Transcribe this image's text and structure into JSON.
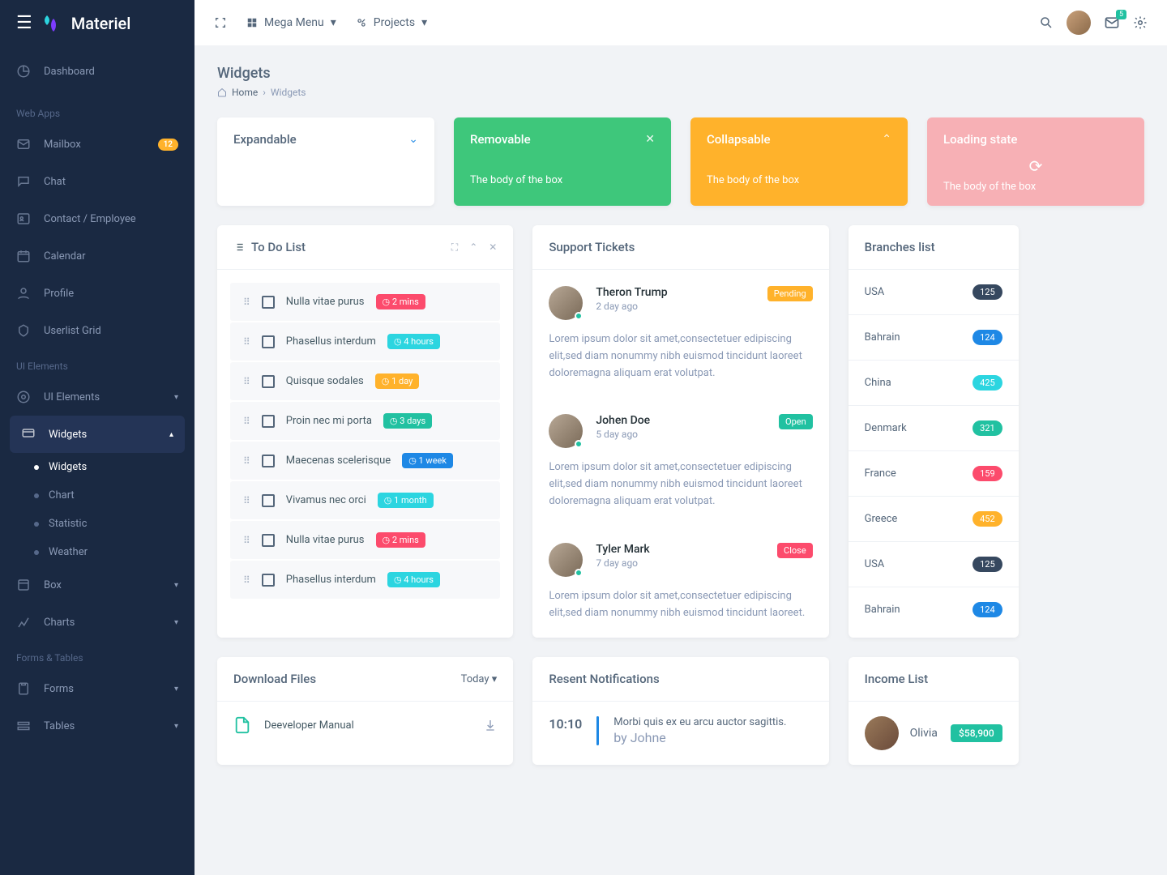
{
  "brand": {
    "name": "Materiel"
  },
  "topbar": {
    "mega_menu": "Mega Menu",
    "projects": "Projects",
    "mail_count": "5"
  },
  "page": {
    "title": "Widgets",
    "crumb_home": "Home",
    "crumb_current": "Widgets"
  },
  "sidebar": {
    "items": [
      {
        "label": "Dashboard"
      }
    ],
    "heading_webapps": "Web Apps",
    "webapps": [
      {
        "label": "Mailbox",
        "badge": "12"
      },
      {
        "label": "Chat"
      },
      {
        "label": "Contact / Employee"
      },
      {
        "label": "Calendar"
      },
      {
        "label": "Profile"
      },
      {
        "label": "Userlist Grid"
      }
    ],
    "heading_ui": "UI Elements",
    "ui_items": [
      {
        "label": "UI Elements"
      },
      {
        "label": "Widgets"
      }
    ],
    "widgets_sub": [
      {
        "label": "Widgets"
      },
      {
        "label": "Chart"
      },
      {
        "label": "Statistic"
      },
      {
        "label": "Weather"
      }
    ],
    "box": "Box",
    "charts": "Charts",
    "heading_forms": "Forms & Tables",
    "forms": "Forms",
    "tables": "Tables"
  },
  "panels": {
    "expandable": "Expandable",
    "removable": "Removable",
    "collapsable": "Collapsable",
    "loading": "Loading state",
    "body": "The body of the box"
  },
  "todo": {
    "title": "To Do List",
    "items": [
      {
        "text": "Nulla vitae purus",
        "badge": "2 mins",
        "cls": "danger"
      },
      {
        "text": "Phasellus interdum",
        "badge": "4 hours",
        "cls": "info"
      },
      {
        "text": "Quisque sodales",
        "badge": "1 day",
        "cls": "warning"
      },
      {
        "text": "Proin nec mi porta",
        "badge": "3 days",
        "cls": "success"
      },
      {
        "text": "Maecenas scelerisque",
        "badge": "1 week",
        "cls": "primary"
      },
      {
        "text": "Vivamus nec orci",
        "badge": "1 month",
        "cls": "info"
      },
      {
        "text": "Nulla vitae purus",
        "badge": "2 mins",
        "cls": "danger"
      },
      {
        "text": "Phasellus interdum",
        "badge": "4 hours",
        "cls": "info"
      }
    ]
  },
  "tickets": {
    "title": "Support Tickets",
    "lorem": "Lorem ipsum dolor sit amet,consectetuer edipiscing elit,sed diam nonummy nibh euismod tincidunt laoreet doloremagna aliquam erat volutpat.",
    "lorem_short": "Lorem ipsum dolor sit amet,consectetuer edipiscing elit,sed diam nonummy nibh euismod tincidunt laoreet.",
    "list": [
      {
        "name": "Theron Trump",
        "time": "2 day ago",
        "status": "Pending",
        "cls": "pending"
      },
      {
        "name": "Johen Doe",
        "time": "5 day ago",
        "status": "Open",
        "cls": "open"
      },
      {
        "name": "Tyler Mark",
        "time": "7 day ago",
        "status": "Close",
        "cls": "close"
      }
    ]
  },
  "branches": {
    "title": "Branches list",
    "list": [
      {
        "name": "USA",
        "badge": "125",
        "color": "#36485f"
      },
      {
        "name": "Bahrain",
        "badge": "124",
        "color": "#1e88e5"
      },
      {
        "name": "China",
        "badge": "425",
        "color": "#2cd5e0"
      },
      {
        "name": "Denmark",
        "badge": "321",
        "color": "#21c1a1"
      },
      {
        "name": "France",
        "badge": "159",
        "color": "#fc4b6c"
      },
      {
        "name": "Greece",
        "badge": "452",
        "color": "#ffb22b"
      },
      {
        "name": "USA",
        "badge": "125",
        "color": "#36485f"
      },
      {
        "name": "Bahrain",
        "badge": "124",
        "color": "#1e88e5"
      }
    ]
  },
  "downloads": {
    "title": "Download Files",
    "today": "Today",
    "file": "Deeveloper Manual"
  },
  "notifications": {
    "title": "Resent Notifications",
    "time": "10:10",
    "text": "Morbi quis ex eu arcu auctor sagittis.",
    "by": "by Johne"
  },
  "income": {
    "title": "Income List",
    "name": "Olivia",
    "amount": "$58,900"
  }
}
